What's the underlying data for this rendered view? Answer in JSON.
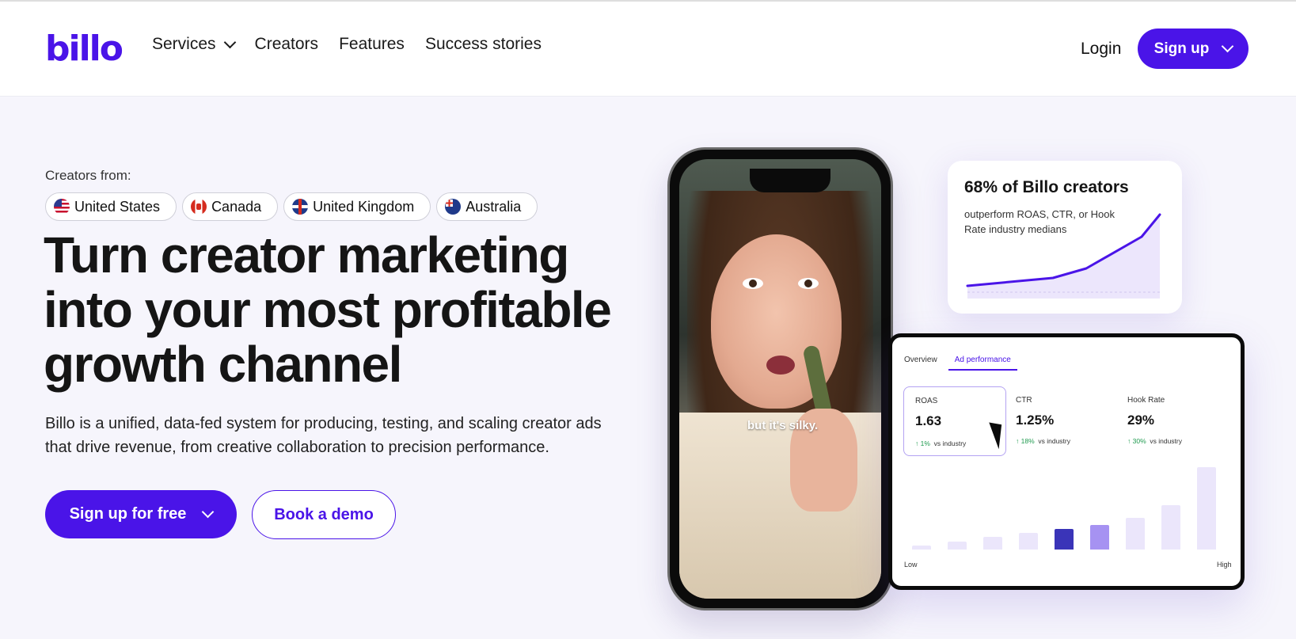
{
  "header": {
    "logo": "billo",
    "nav": [
      {
        "label": "Services",
        "has_dropdown": true
      },
      {
        "label": "Creators"
      },
      {
        "label": "Features"
      },
      {
        "label": "Success stories"
      }
    ],
    "login_label": "Login",
    "signup_label": "Sign up"
  },
  "hero": {
    "creators_from_label": "Creators from:",
    "countries": [
      {
        "label": "United States",
        "icon": "us-flag-icon"
      },
      {
        "label": "Canada",
        "icon": "canada-flag-icon"
      },
      {
        "label": "United Kingdom",
        "icon": "uk-flag-icon"
      },
      {
        "label": "Australia",
        "icon": "australia-flag-icon"
      }
    ],
    "title": "Turn creator marketing into your most profitable growth channel",
    "subtitle": "Billo is a unified, data-fed system for producing, testing, and scaling creator ads that drive revenue, from creative collaboration to precision performance.",
    "primary_cta": "Sign up for free",
    "secondary_cta": "Book a demo"
  },
  "phone": {
    "caption": "but it's silky."
  },
  "stat_card": {
    "title": "68% of Billo creators",
    "description": "outperform ROAS, CTR, or Hook Rate industry medians"
  },
  "dashboard": {
    "tabs": [
      {
        "label": "Overview",
        "active": false
      },
      {
        "label": "Ad performance",
        "active": true
      }
    ],
    "metrics": [
      {
        "label": "ROAS",
        "value": "1.63",
        "delta": "1%",
        "suffix": "vs industry",
        "selected": true
      },
      {
        "label": "CTR",
        "value": "1.25%",
        "delta": "18%",
        "suffix": "vs industry",
        "selected": false
      },
      {
        "label": "Hook Rate",
        "value": "29%",
        "delta": "30%",
        "suffix": "vs industry",
        "selected": false
      }
    ],
    "axis_low": "Low",
    "axis_high": "High",
    "distribution": [
      0.05,
      0.1,
      0.15,
      0.2,
      0.25,
      0.3,
      0.38,
      0.54,
      1.0
    ],
    "highlight_index": 4,
    "bar_colors": {
      "base": "#ebe6fb",
      "highlight": "#3a34b8",
      "accent": "#a692f2"
    }
  },
  "colors": {
    "brand": "#4a14e8",
    "background": "#f6f5fc"
  }
}
